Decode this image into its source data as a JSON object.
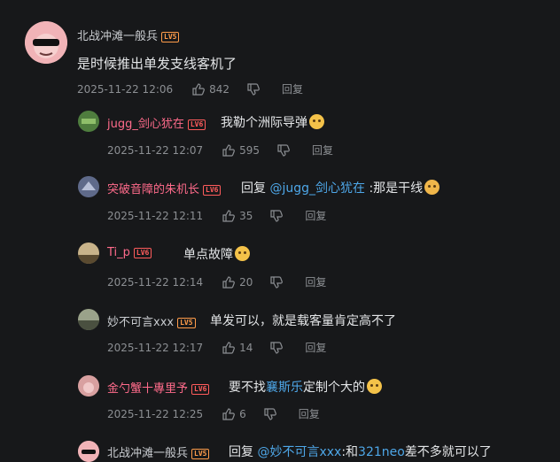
{
  "main_comment": {
    "username": "北战冲滩一般兵",
    "level": "LV5",
    "text": "是时候推出单发支线客机了",
    "time": "2025-11-22 12:06",
    "likes": "842",
    "reply_label": "回复"
  },
  "replies": [
    {
      "username": "jugg_剑心犹在",
      "level": "LV6",
      "text": "我勒个洲际导弹",
      "time": "2025-11-22 12:07",
      "likes": "595",
      "reply_label": "回复"
    },
    {
      "username": "突破音障的朱机长",
      "level": "LV6",
      "reply_prefix": "回复",
      "at_user": "@jugg_剑心犹在",
      "text": ":那是干线",
      "time": "2025-11-22 12:11",
      "likes": "35",
      "reply_label": "回复"
    },
    {
      "username": "Ti_p",
      "level": "LV6",
      "text": "单点故障",
      "time": "2025-11-22 12:14",
      "likes": "20",
      "reply_label": "回复"
    },
    {
      "username": "妙不可言xxx",
      "level": "LV5",
      "text": "单发可以，就是载客量肯定高不了",
      "time": "2025-11-22 12:17",
      "likes": "14",
      "reply_label": "回复"
    },
    {
      "username": "金勺蟹十專里予",
      "level": "LV6",
      "text_before": "要不找",
      "at_user": "襄斯乐",
      "text": "定制个大的",
      "time": "2025-11-22 12:25",
      "likes": "6",
      "reply_label": "回复"
    },
    {
      "username": "北战冲滩一般兵",
      "level": "LV5",
      "reply_prefix": "回复",
      "at_user": "@妙不可言xxx",
      "text_mid": ":和",
      "at_user2": "321neo",
      "text": "差不多就可以了"
    }
  ]
}
